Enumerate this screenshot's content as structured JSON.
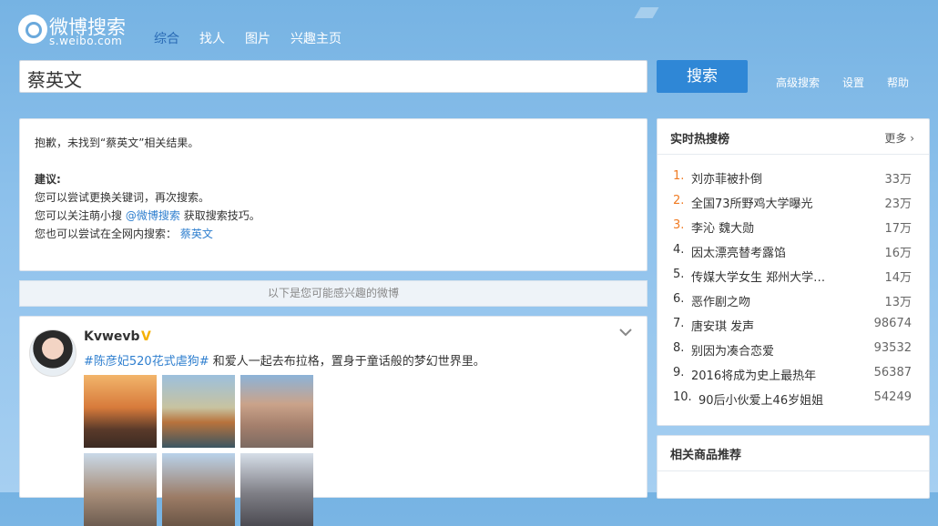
{
  "logo": {
    "title": "微博搜索",
    "subtitle": "s.weibo.com"
  },
  "nav": [
    "综合",
    "找人",
    "图片",
    "兴趣主页"
  ],
  "search": {
    "query": "蔡英文",
    "button": "搜索"
  },
  "top_links": [
    "高级搜索",
    "设置",
    "帮助"
  ],
  "notice": {
    "line1": "抱歉，未找到“蔡英文”相关结果。",
    "sugg_title": "建议:",
    "sugg1": "您可以尝试更换关键词，再次搜索。",
    "sugg2_pre": "您可以关注萌小搜",
    "sugg2_link": "@微博搜索",
    "sugg2_post": "获取搜索技巧。",
    "sugg3_pre": "您也可以尝试在全网内搜索：",
    "sugg3_link": "蔡英文"
  },
  "interest_bar": "以下是您可能感兴趣的微博",
  "feed": {
    "username": "Kvwevb",
    "badge": "V",
    "tag": "#陈彦妃520花式虐狗#",
    "text": " 和爱人一起去布拉格，置身于童话般的梦幻世界里。"
  },
  "hot": {
    "title": "实时热搜榜",
    "more": "更多",
    "items": [
      {
        "rank": "1.",
        "text": "刘亦菲被扑倒",
        "count": "33万"
      },
      {
        "rank": "2.",
        "text": "全国73所野鸡大学曝光",
        "count": "23万"
      },
      {
        "rank": "3.",
        "text": "李沁 魏大勋",
        "count": "17万"
      },
      {
        "rank": "4.",
        "text": "因太漂亮替考露馅",
        "count": "16万"
      },
      {
        "rank": "5.",
        "text": "传媒大学女生 郑州大学…",
        "count": "14万"
      },
      {
        "rank": "6.",
        "text": "恶作剧之吻",
        "count": "13万"
      },
      {
        "rank": "7.",
        "text": "唐安琪 发声",
        "count": "98674"
      },
      {
        "rank": "8.",
        "text": "别因为凑合恋爱",
        "count": "93532"
      },
      {
        "rank": "9.",
        "text": "2016将成为史上最热年",
        "count": "56387"
      },
      {
        "rank": "10.",
        "text": "90后小伙爱上46岁姐姐",
        "count": "54249"
      }
    ]
  },
  "goods": {
    "title": "相关商品推荐"
  },
  "icons": {
    "chevron": "chevron-down-icon",
    "more_arrow": "chevron-right-icon"
  }
}
